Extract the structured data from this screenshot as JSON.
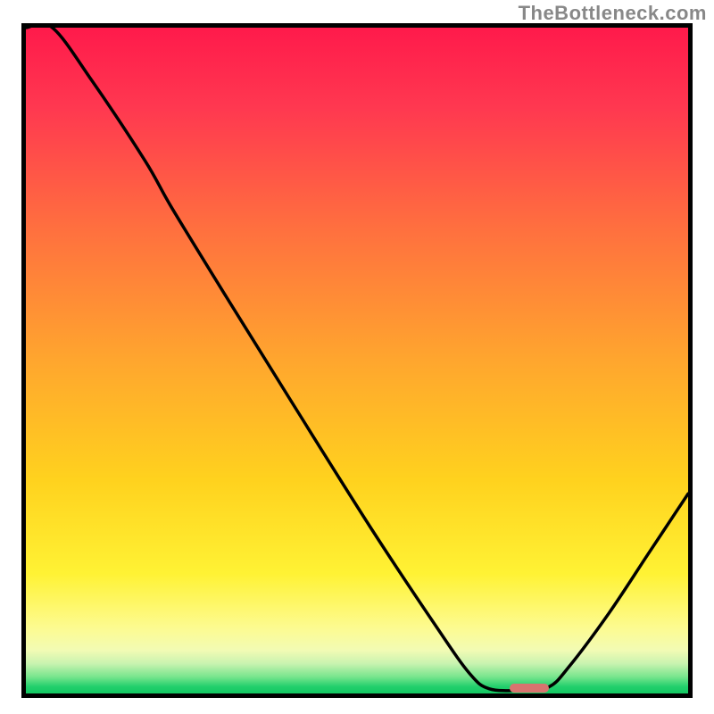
{
  "chart_data": {
    "type": "line",
    "watermark": "TheBottleneck.com",
    "gradient_stops": [
      {
        "offset": 0.0,
        "color": "#ff1a4b"
      },
      {
        "offset": 0.12,
        "color": "#ff3850"
      },
      {
        "offset": 0.3,
        "color": "#ff6f3f"
      },
      {
        "offset": 0.5,
        "color": "#ffa62e"
      },
      {
        "offset": 0.68,
        "color": "#ffd21e"
      },
      {
        "offset": 0.82,
        "color": "#fff234"
      },
      {
        "offset": 0.9,
        "color": "#fdfb8f"
      },
      {
        "offset": 0.935,
        "color": "#f2fbb4"
      },
      {
        "offset": 0.955,
        "color": "#c9f3b0"
      },
      {
        "offset": 0.975,
        "color": "#78e58d"
      },
      {
        "offset": 0.99,
        "color": "#21cf6c"
      },
      {
        "offset": 1.0,
        "color": "#14c862"
      }
    ],
    "x_range": [
      0,
      100
    ],
    "y_range": [
      0,
      100
    ],
    "curve": [
      {
        "x": 0,
        "y": 100
      },
      {
        "x": 4,
        "y": 100
      },
      {
        "x": 10,
        "y": 92
      },
      {
        "x": 18,
        "y": 80
      },
      {
        "x": 22,
        "y": 73
      },
      {
        "x": 30,
        "y": 60
      },
      {
        "x": 40,
        "y": 44
      },
      {
        "x": 52,
        "y": 25
      },
      {
        "x": 62,
        "y": 10
      },
      {
        "x": 67,
        "y": 3
      },
      {
        "x": 70,
        "y": 0.7
      },
      {
        "x": 75,
        "y": 0.5
      },
      {
        "x": 79,
        "y": 1
      },
      {
        "x": 82,
        "y": 4
      },
      {
        "x": 88,
        "y": 12
      },
      {
        "x": 94,
        "y": 21
      },
      {
        "x": 100,
        "y": 30
      }
    ],
    "optimum_marker": {
      "x_start": 73,
      "x_end": 79,
      "y": 0.8,
      "color": "#d9746f"
    }
  }
}
